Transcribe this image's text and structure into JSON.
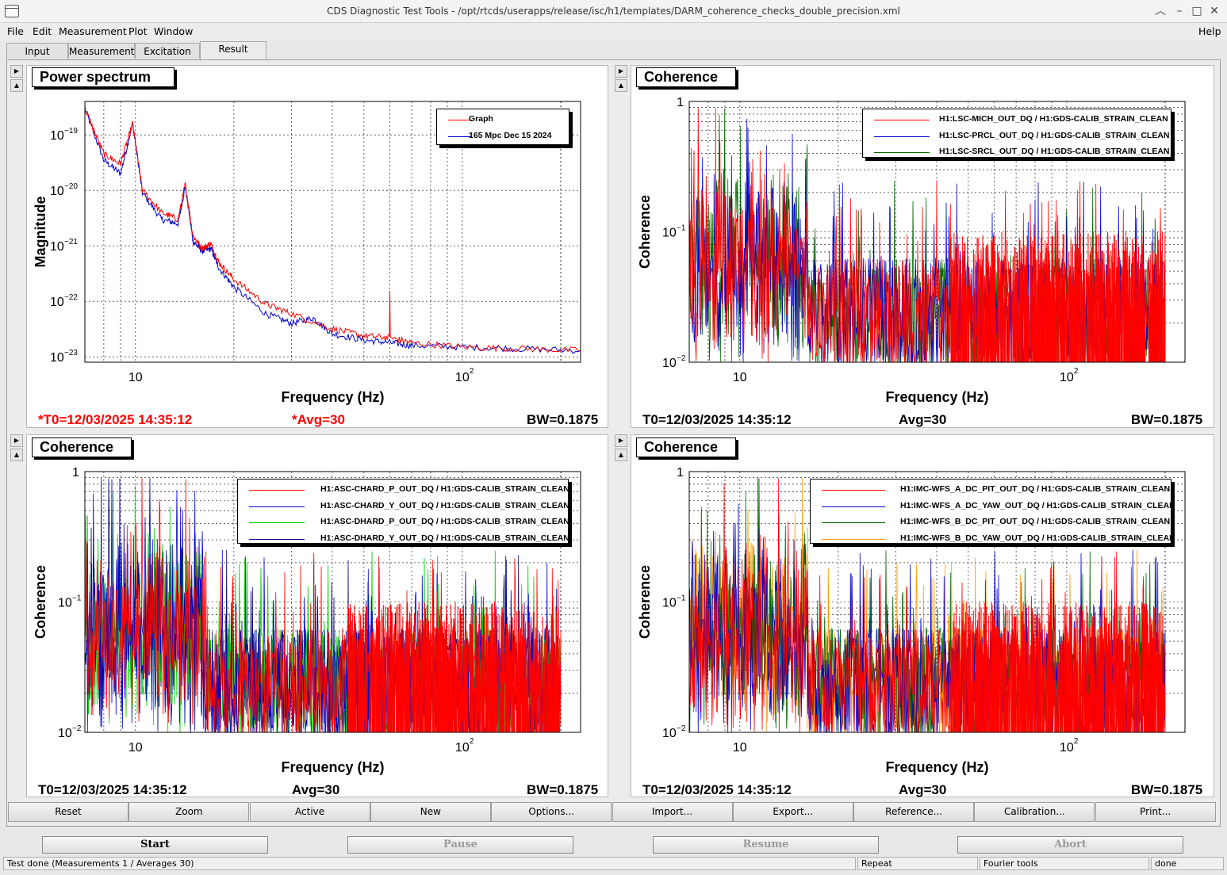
{
  "window": {
    "title": "CDS Diagnostic Test Tools - /opt/rtcds/userapps/release/isc/h1/templates/DARM_coherence_checks_double_precision.xml",
    "controls": [
      "︿",
      "–",
      "□",
      "✕"
    ]
  },
  "menu": {
    "file": "File",
    "edit": "Edit",
    "measurement": "Measurement",
    "plot": "Plot",
    "window": "Window",
    "help": "Help"
  },
  "tabs": [
    "Input",
    "Measurement",
    "Excitation",
    "Result"
  ],
  "colors": {
    "red": "#ff0000",
    "blue": "#0000cc",
    "darkgreen": "#006600",
    "green": "#00cc00",
    "navy": "#000080",
    "orange": "#ff9900"
  },
  "pads": [
    {
      "title": "Power spectrum",
      "footer": {
        "t0": "*T0=12/03/2025 14:35:12",
        "avg": "*Avg=30",
        "bw": "BW=0.1875",
        "t0_red": true
      },
      "legend": [
        {
          "label": "Graph",
          "color": "#ff0000"
        },
        {
          "label": "165 Mpc Dec 15 2024",
          "color": "#0000cc"
        }
      ],
      "chart_data": {
        "type": "line",
        "xlabel": "Frequency (Hz)",
        "ylabel": "Magnitude",
        "xscale": "log",
        "yscale": "log",
        "xlim": [
          7,
          230
        ],
        "ylim": [
          8e-24,
          4e-19
        ],
        "yticks": [
          "-19",
          "-20",
          "-21",
          "-22",
          "-23"
        ],
        "series": [
          {
            "name": "Graph",
            "color": "#ff0000",
            "x": [
              7,
              8,
              9,
              9.8,
              10.5,
              12,
              13.5,
              14.2,
              15,
              16,
              17,
              18,
              20,
              25,
              30,
              40,
              50,
              59.8,
              60,
              60.2,
              70,
              100,
              150,
              230
            ],
            "y": [
              3e-19,
              4.5e-20,
              3e-20,
              1.6e-19,
              1e-20,
              4e-21,
              3e-21,
              1.3e-20,
              1.5e-21,
              9e-22,
              1.1e-21,
              5e-22,
              2.5e-22,
              9e-23,
              6e-23,
              3.2e-23,
              2.4e-23,
              2.2e-23,
              1.6e-22,
              2.2e-23,
              1.8e-23,
              1.5e-23,
              1.4e-23,
              1.3e-23
            ]
          },
          {
            "name": "165 Mpc Dec 15 2024",
            "color": "#0000cc",
            "x": [
              7,
              8,
              9,
              9.8,
              10.5,
              12,
              13.5,
              14.2,
              15,
              16,
              17,
              18,
              20,
              25,
              30,
              35,
              40,
              50,
              60,
              70,
              100,
              150,
              230
            ],
            "y": [
              3e-19,
              3.5e-20,
              2e-20,
              1.6e-19,
              9e-21,
              3e-21,
              2.5e-21,
              1.2e-20,
              1.2e-21,
              8e-22,
              9e-22,
              4e-22,
              1.8e-22,
              6e-23,
              4e-23,
              5e-23,
              2.6e-23,
              2e-23,
              1.8e-23,
              1.6e-23,
              1.5e-23,
              1.4e-23,
              1.3e-23
            ]
          }
        ]
      }
    },
    {
      "title": "Coherence",
      "footer": {
        "t0": "T0=12/03/2025 14:35:12",
        "avg": "Avg=30",
        "bw": "BW=0.1875",
        "t0_red": false
      },
      "legend": [
        {
          "label": "H1:LSC-MICH_OUT_DQ / H1:GDS-CALIB_STRAIN_CLEAN",
          "color": "#ff0000"
        },
        {
          "label": "H1:LSC-PRCL_OUT_DQ / H1:GDS-CALIB_STRAIN_CLEAN",
          "color": "#0000cc"
        },
        {
          "label": "H1:LSC-SRCL_OUT_DQ / H1:GDS-CALIB_STRAIN_CLEAN",
          "color": "#006600"
        }
      ],
      "chart_data": {
        "type": "line",
        "xlabel": "Frequency (Hz)",
        "ylabel": "Coherence",
        "xscale": "log",
        "yscale": "log",
        "xlim": [
          7,
          230
        ],
        "ylim": [
          0.01,
          1
        ],
        "series": [
          {
            "name": "H1:LSC-MICH_OUT_DQ / H1:GDS-CALIB_STRAIN_CLEAN",
            "color": "#ff0000"
          },
          {
            "name": "H1:LSC-PRCL_OUT_DQ / H1:GDS-CALIB_STRAIN_CLEAN",
            "color": "#0000cc"
          },
          {
            "name": "H1:LSC-SRCL_OUT_DQ / H1:GDS-CALIB_STRAIN_CLEAN",
            "color": "#006600"
          }
        ]
      }
    },
    {
      "title": "Coherence",
      "footer": {
        "t0": "T0=12/03/2025 14:35:12",
        "avg": "Avg=30",
        "bw": "BW=0.1875",
        "t0_red": false
      },
      "legend": [
        {
          "label": "H1:ASC-CHARD_P_OUT_DQ / H1:GDS-CALIB_STRAIN_CLEAN",
          "color": "#ff0000"
        },
        {
          "label": "H1:ASC-CHARD_Y_OUT_DQ / H1:GDS-CALIB_STRAIN_CLEAN",
          "color": "#0000cc"
        },
        {
          "label": "H1:ASC-DHARD_P_OUT_DQ / H1:GDS-CALIB_STRAIN_CLEAN",
          "color": "#00cc00"
        },
        {
          "label": "H1:ASC-DHARD_Y_OUT_DQ / H1:GDS-CALIB_STRAIN_CLEAN",
          "color": "#000080"
        }
      ],
      "chart_data": {
        "type": "line",
        "xlabel": "Frequency (Hz)",
        "ylabel": "Coherence",
        "xscale": "log",
        "yscale": "log",
        "xlim": [
          7,
          230
        ],
        "ylim": [
          0.01,
          1
        ],
        "series": [
          {
            "name": "H1:ASC-CHARD_P_OUT_DQ / H1:GDS-CALIB_STRAIN_CLEAN",
            "color": "#ff0000"
          },
          {
            "name": "H1:ASC-CHARD_Y_OUT_DQ / H1:GDS-CALIB_STRAIN_CLEAN",
            "color": "#0000cc"
          },
          {
            "name": "H1:ASC-DHARD_P_OUT_DQ / H1:GDS-CALIB_STRAIN_CLEAN",
            "color": "#00cc00"
          },
          {
            "name": "H1:ASC-DHARD_Y_OUT_DQ / H1:GDS-CALIB_STRAIN_CLEAN",
            "color": "#000080"
          }
        ]
      }
    },
    {
      "title": "Coherence",
      "footer": {
        "t0": "T0=12/03/2025 14:35:12",
        "avg": "Avg=30",
        "bw": "BW=0.1875",
        "t0_red": false
      },
      "legend": [
        {
          "label": "H1:IMC-WFS_A_DC_PIT_OUT_DQ / H1:GDS-CALIB_STRAIN_CLEAN",
          "color": "#ff0000"
        },
        {
          "label": "H1:IMC-WFS_A_DC_YAW_OUT_DQ / H1:GDS-CALIB_STRAIN_CLEAN",
          "color": "#0000cc"
        },
        {
          "label": "H1:IMC-WFS_B_DC_PIT_OUT_DQ / H1:GDS-CALIB_STRAIN_CLEAN",
          "color": "#006600"
        },
        {
          "label": "H1:IMC-WFS_B_DC_YAW_OUT_DQ / H1:GDS-CALIB_STRAIN_CLEAN",
          "color": "#ff9900"
        }
      ],
      "chart_data": {
        "type": "line",
        "xlabel": "Frequency (Hz)",
        "ylabel": "Coherence",
        "xscale": "log",
        "yscale": "log",
        "xlim": [
          7,
          230
        ],
        "ylim": [
          0.01,
          1
        ],
        "series": [
          {
            "name": "H1:IMC-WFS_A_DC_PIT_OUT_DQ / H1:GDS-CALIB_STRAIN_CLEAN",
            "color": "#ff0000"
          },
          {
            "name": "H1:IMC-WFS_A_DC_YAW_OUT_DQ / H1:GDS-CALIB_STRAIN_CLEAN",
            "color": "#0000cc"
          },
          {
            "name": "H1:IMC-WFS_B_DC_PIT_OUT_DQ / H1:GDS-CALIB_STRAIN_CLEAN",
            "color": "#006600"
          },
          {
            "name": "H1:IMC-WFS_B_DC_YAW_OUT_DQ / H1:GDS-CALIB_STRAIN_CLEAN",
            "color": "#ff9900"
          }
        ]
      }
    }
  ],
  "toolbar": [
    "Reset",
    "Zoom",
    "Active",
    "New",
    "Options...",
    "Import...",
    "Export...",
    "Reference...",
    "Calibration...",
    "Print..."
  ],
  "controls": {
    "start": "Start",
    "pause": "Pause",
    "resume": "Resume",
    "abort": "Abort"
  },
  "status": {
    "message": "Test done (Measurements 1 / Averages 30)",
    "repeat": "Repeat",
    "tool": "Fourier tools",
    "state": "done"
  }
}
